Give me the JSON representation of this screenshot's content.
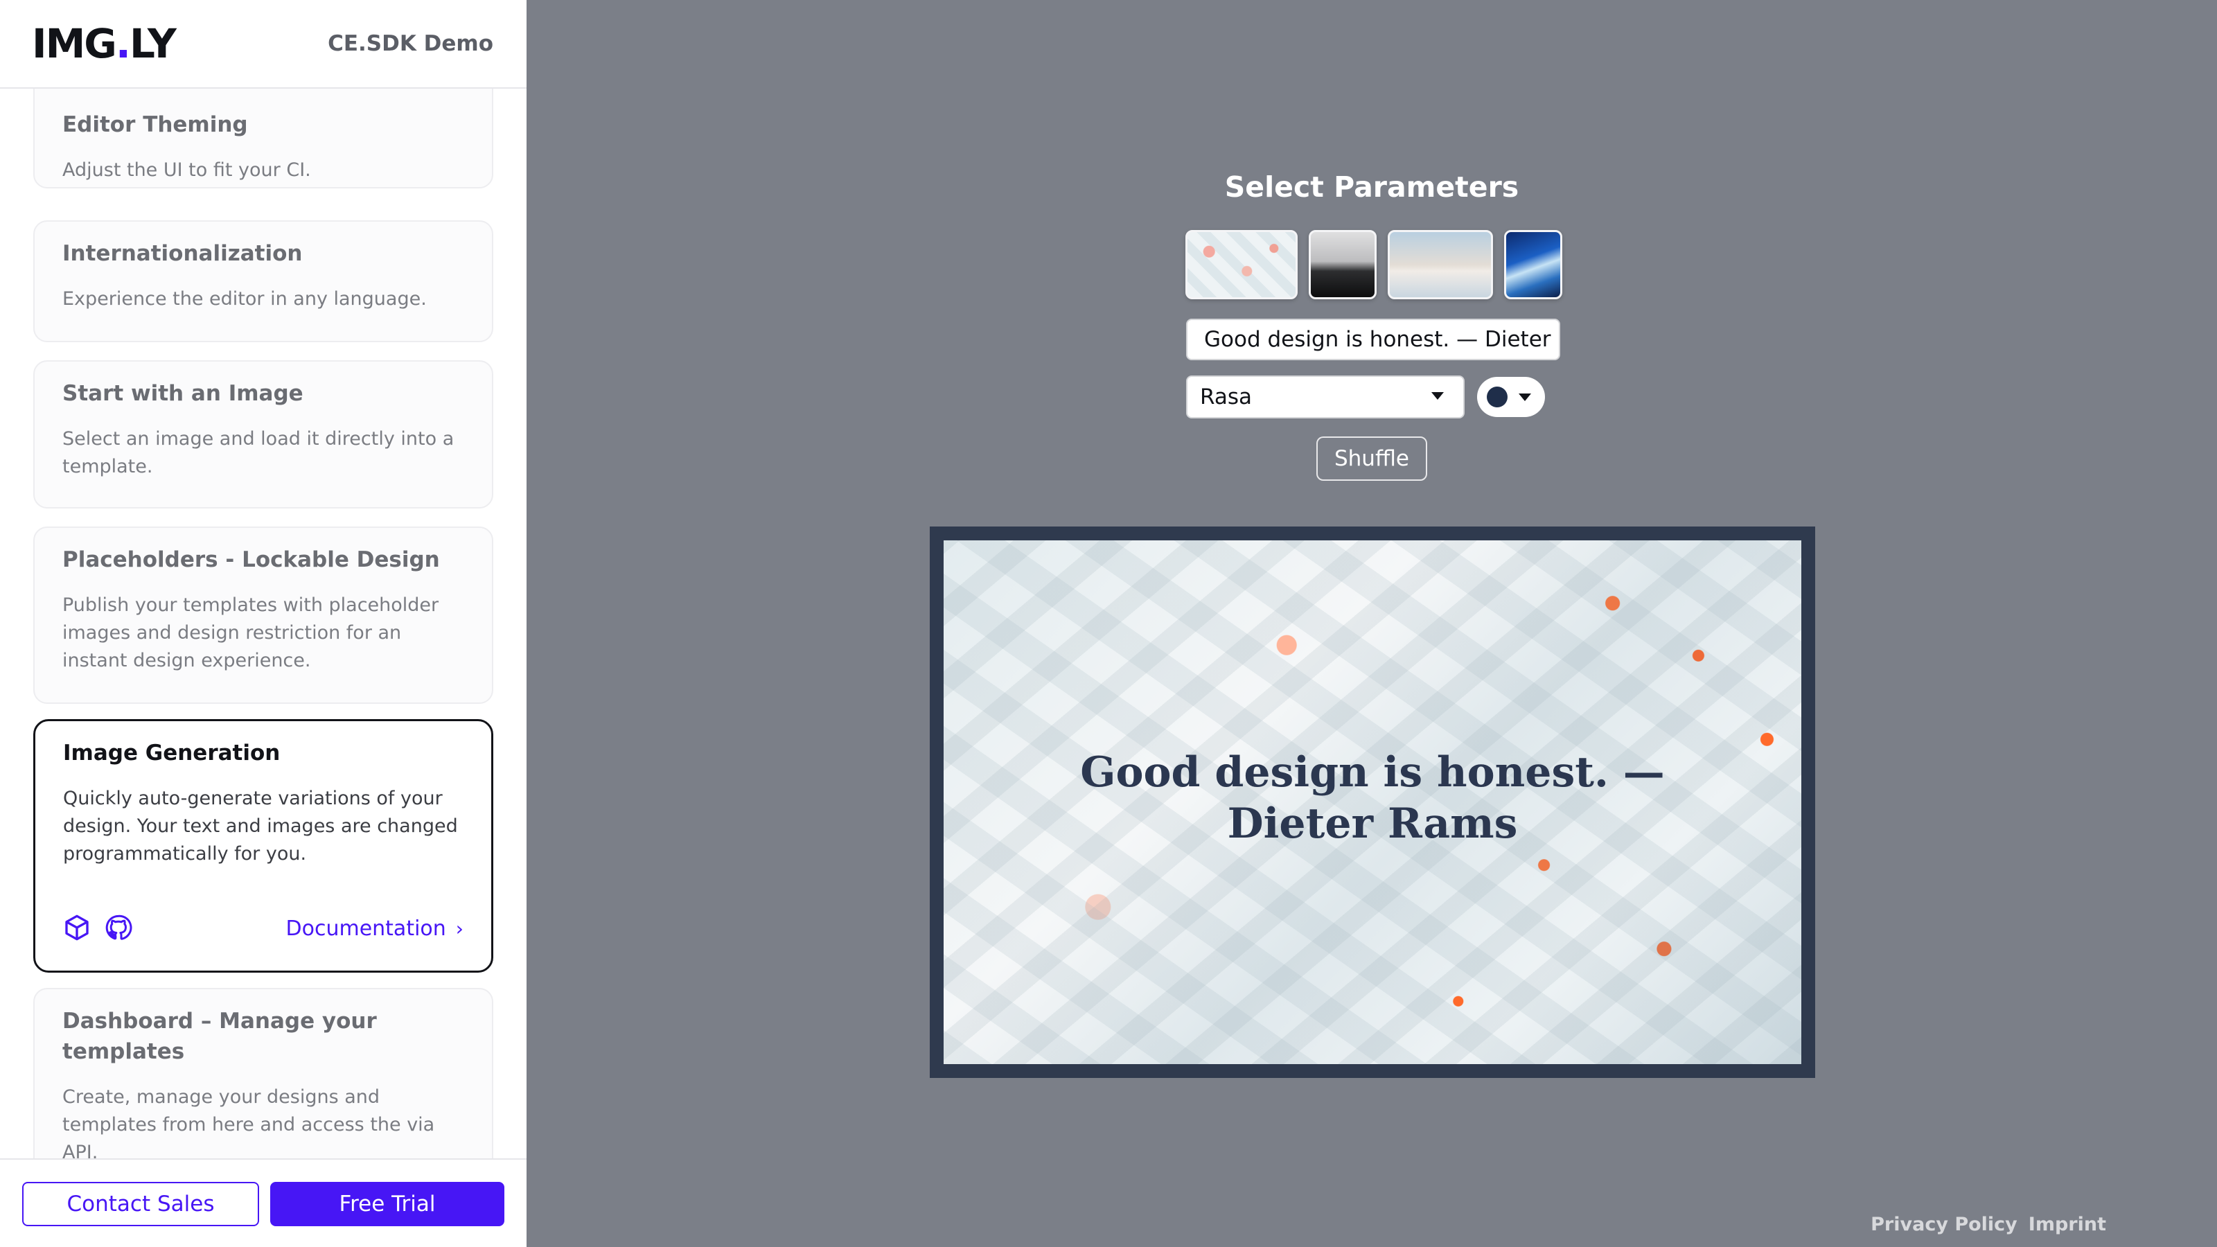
{
  "sidebar": {
    "logo_text": "IMG.LY",
    "subtitle": "CE.SDK Demo",
    "cards": [
      {
        "title": "Editor Theming",
        "description": "Adjust the UI to fit your CI."
      },
      {
        "title": "Internationalization",
        "description": "Experience the editor in any language."
      },
      {
        "title": "Start with an Image",
        "description": "Select an image and load it directly into a template."
      },
      {
        "title": "Placeholders - Lockable Design",
        "description": "Publish your templates with placeholder images and design restriction for an instant design experience."
      },
      {
        "title": "Image Generation",
        "description": "Quickly auto-generate variations of your design. Your text and images are changed programmatically for you.",
        "link_label": "Documentation",
        "icons": [
          "cube-icon",
          "github-icon"
        ]
      },
      {
        "title": "Dashboard – Manage your templates",
        "description": "Create, manage your designs and templates from here and access the via API."
      }
    ],
    "footer": {
      "contact_label": "Contact Sales",
      "trial_label": "Free Trial"
    }
  },
  "main": {
    "title": "Select Parameters",
    "thumbnails": [
      "abstract-geometric-thumbnail",
      "black-white-landscape-thumbnail",
      "pastel-sky-thumbnail",
      "blue-abstract-thumbnail"
    ],
    "text_value": "Good design is honest. — Dieter R",
    "font_value": "Rasa",
    "color_value": "#1f2e4a",
    "shuffle_label": "Shuffle",
    "canvas_quote": "Good design is honest. — Dieter Rams"
  },
  "footer_links": {
    "privacy": "Privacy Policy",
    "imprint": "Imprint"
  },
  "colors": {
    "accent": "#4716f5",
    "background": "#7b7f88",
    "canvas_frame": "#2f3a4e"
  }
}
